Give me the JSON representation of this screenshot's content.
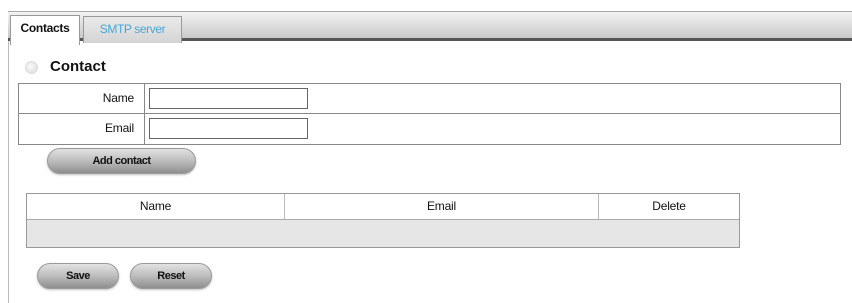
{
  "tabs": [
    {
      "label": "Contacts",
      "active": true
    },
    {
      "label": "SMTP server",
      "active": false
    }
  ],
  "section": {
    "title": "Contact"
  },
  "form": {
    "name_label": "Name",
    "name_value": "",
    "email_label": "Email",
    "email_value": ""
  },
  "buttons": {
    "add_contact": "Add contact",
    "save": "Save",
    "reset": "Reset"
  },
  "contacts_table": {
    "columns": [
      "Name",
      "Email",
      "Delete"
    ],
    "rows": []
  },
  "colors": {
    "tab_inactive_text": "#45a8d8",
    "tab_bar_border": "#555555",
    "empty_row_bg": "#e6e6e6"
  },
  "icons": {
    "section_marker": "circle-bullet-icon"
  }
}
